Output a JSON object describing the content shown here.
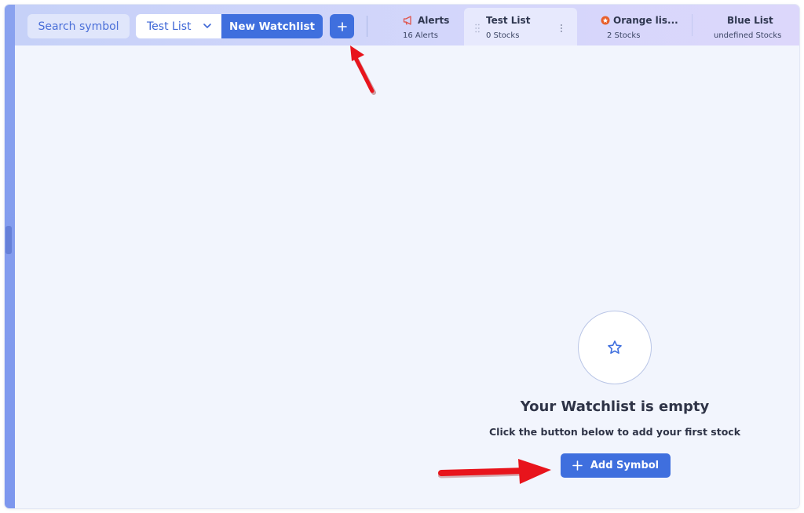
{
  "toolbar": {
    "search_label": "Search symbol",
    "list_select_value": "Test List",
    "new_watchlist_label": "New Watchlist",
    "add_icon": "plus-icon"
  },
  "tabs": [
    {
      "title": "Alerts",
      "subtitle": "16 Alerts",
      "icon": "megaphone-icon"
    },
    {
      "title": "Test List",
      "subtitle": "0 Stocks",
      "icon": "drag-handle-icon",
      "active": true
    },
    {
      "title": "Orange lis...",
      "subtitle": "2 Stocks",
      "icon": "orange-dot-icon"
    },
    {
      "title": "Blue List",
      "subtitle": "undefined Stocks"
    }
  ],
  "empty_state": {
    "icon": "star-icon",
    "title": "Your Watchlist is empty",
    "subtitle": "Click the button below to add your first stock",
    "button_label": "Add Symbol"
  },
  "colors": {
    "accent": "#3f6fde",
    "alert_icon": "#e0534a",
    "orange_icon": "#e8602c",
    "annotation_arrow": "#e8141c"
  }
}
